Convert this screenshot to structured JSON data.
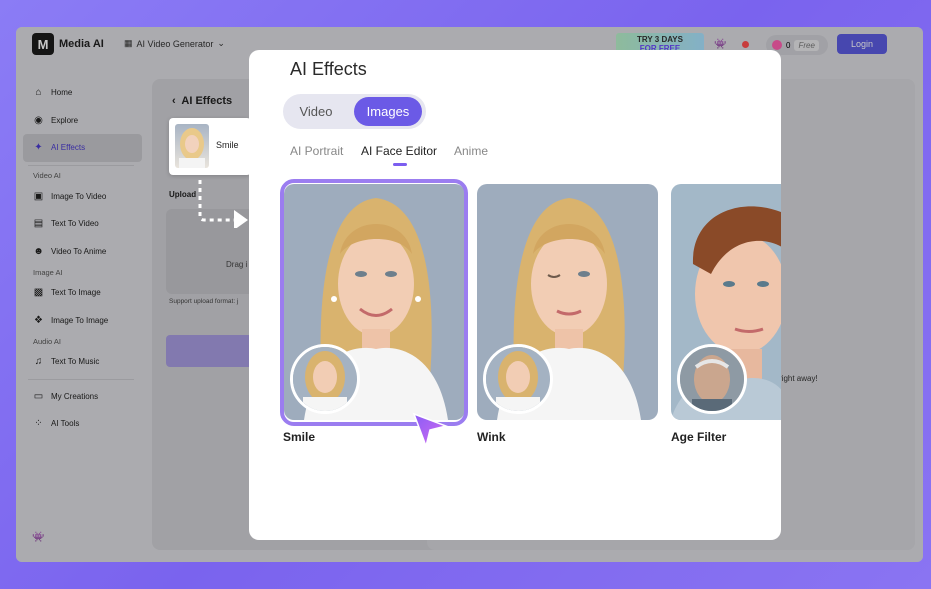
{
  "app": {
    "logo_letter": "M",
    "brand": "Media AI",
    "generator_selector": "AI Video Generator",
    "banner_line1": "TRY 3 DAYS",
    "banner_line2": "FOR FREE",
    "coins": "0",
    "free_tag": "Free",
    "login": "Login"
  },
  "sidebar": {
    "items_top": [
      {
        "label": "Home",
        "icon": "home-icon"
      },
      {
        "label": "Explore",
        "icon": "compass-icon"
      },
      {
        "label": "AI Effects",
        "icon": "sparkle-icon"
      }
    ],
    "group_video": "Video AI",
    "video_items": [
      {
        "label": "Image To Video"
      },
      {
        "label": "Text To Video"
      },
      {
        "label": "Video To Anime"
      }
    ],
    "group_image": "Image AI",
    "image_items": [
      {
        "label": "Text To Image"
      },
      {
        "label": "Image To Image"
      }
    ],
    "group_audio": "Audio AI",
    "audio_items": [
      {
        "label": "Text To Music"
      }
    ],
    "bottom_items": [
      {
        "label": "My Creations"
      },
      {
        "label": "AI Tools"
      }
    ]
  },
  "background_page": {
    "back_title": "AI Effects",
    "chip_label": "Smile",
    "upload_label": "Upload",
    "drag_text": "Drag i",
    "support_text": "Support upload format: j",
    "right_text": "right away!"
  },
  "modal": {
    "title": "AI Effects",
    "mode_tabs": [
      "Video",
      "Images"
    ],
    "active_mode": "Images",
    "sub_tabs": [
      "AI Portrait",
      "AI Face Editor",
      "Anime"
    ],
    "active_sub_tab": "AI Face Editor",
    "cards": [
      {
        "label": "Smile",
        "selected": true
      },
      {
        "label": "Wink",
        "selected": false
      },
      {
        "label": "Age Filter",
        "selected": false
      }
    ]
  },
  "colors": {
    "accent": "#6b5ae6",
    "selection_border": "#9b7df0",
    "login_button": "#5b5be0"
  }
}
